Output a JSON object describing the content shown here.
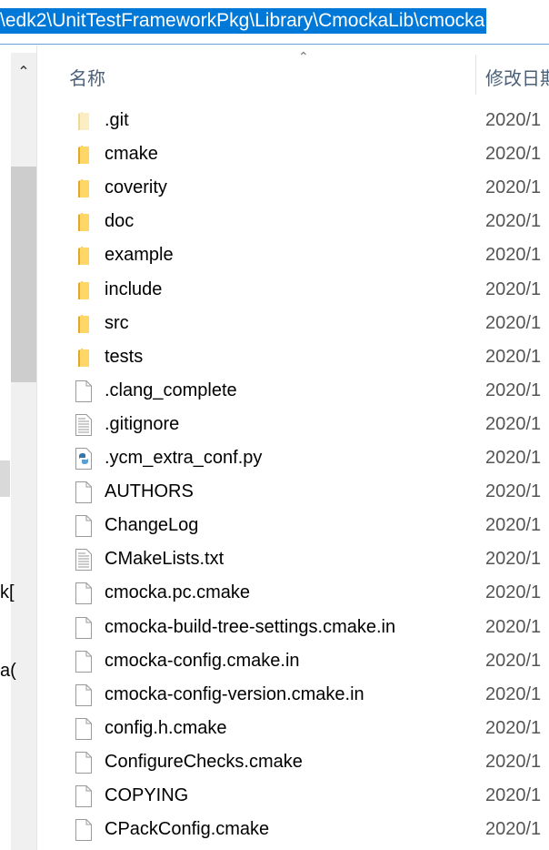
{
  "address": {
    "path": "\\edk2\\UnitTestFrameworkPkg\\Library\\CmockaLib\\cmocka"
  },
  "nav": {
    "fragments": [
      "k[",
      "a("
    ]
  },
  "header": {
    "name": "名称",
    "date": "修改日期"
  },
  "files": [
    {
      "name": ".git",
      "type": "folder-faded",
      "date": "2020/1"
    },
    {
      "name": "cmake",
      "type": "folder",
      "date": "2020/1"
    },
    {
      "name": "coverity",
      "type": "folder",
      "date": "2020/1"
    },
    {
      "name": "doc",
      "type": "folder",
      "date": "2020/1"
    },
    {
      "name": "example",
      "type": "folder",
      "date": "2020/1"
    },
    {
      "name": "include",
      "type": "folder",
      "date": "2020/1"
    },
    {
      "name": "src",
      "type": "folder",
      "date": "2020/1"
    },
    {
      "name": "tests",
      "type": "folder",
      "date": "2020/1"
    },
    {
      "name": ".clang_complete",
      "type": "file",
      "date": "2020/1"
    },
    {
      "name": ".gitignore",
      "type": "text",
      "date": "2020/1"
    },
    {
      "name": ".ycm_extra_conf.py",
      "type": "python",
      "date": "2020/1"
    },
    {
      "name": "AUTHORS",
      "type": "file",
      "date": "2020/1"
    },
    {
      "name": "ChangeLog",
      "type": "file",
      "date": "2020/1"
    },
    {
      "name": "CMakeLists.txt",
      "type": "text",
      "date": "2020/1"
    },
    {
      "name": "cmocka.pc.cmake",
      "type": "file",
      "date": "2020/1"
    },
    {
      "name": "cmocka-build-tree-settings.cmake.in",
      "type": "file",
      "date": "2020/1"
    },
    {
      "name": "cmocka-config.cmake.in",
      "type": "file",
      "date": "2020/1"
    },
    {
      "name": "cmocka-config-version.cmake.in",
      "type": "file",
      "date": "2020/1"
    },
    {
      "name": "config.h.cmake",
      "type": "file",
      "date": "2020/1"
    },
    {
      "name": "ConfigureChecks.cmake",
      "type": "file",
      "date": "2020/1"
    },
    {
      "name": "COPYING",
      "type": "file",
      "date": "2020/1"
    },
    {
      "name": "CPackConfig.cmake",
      "type": "file",
      "date": "2020/1"
    }
  ]
}
